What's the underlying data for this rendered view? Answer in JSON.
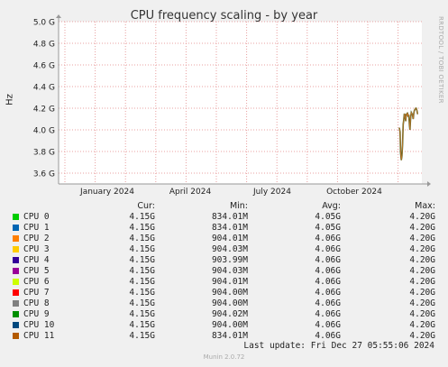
{
  "chart_data": {
    "type": "line",
    "title": "CPU frequency scaling - by year",
    "ylabel": "Hz",
    "y_ticks": [
      "3.6 G",
      "3.8 G",
      "4.0 G",
      "4.2 G",
      "4.4 G",
      "4.6 G",
      "4.8 G",
      "5.0 G"
    ],
    "y_tick_values": [
      3.6,
      3.8,
      4.0,
      4.2,
      4.4,
      4.6,
      4.8,
      5.0
    ],
    "ylim": [
      3.5,
      5.0
    ],
    "x_ticks": [
      "January 2024",
      "April 2024",
      "July 2024",
      "October 2024"
    ],
    "grid": true,
    "series_color": "#b8732a",
    "series_days": [
      0,
      0.7,
      1.4,
      2,
      2.6,
      3.2,
      3.9,
      4.5,
      5.1,
      5.8,
      6.4,
      7,
      7.6,
      8.2,
      8.9,
      9.5,
      10.1,
      10.7,
      11.4,
      12,
      12.6,
      13.2,
      13.9,
      14.5,
      15.1,
      15.8,
      16.4,
      17,
      17.6,
      18.3,
      18.9
    ],
    "series_values": [
      4.02,
      3.98,
      3.78,
      3.72,
      3.76,
      3.85,
      4.05,
      4.1,
      4.15,
      4.12,
      4.08,
      4.15,
      4.13,
      4.16,
      4.12,
      4.14,
      4.05,
      4.0,
      4.12,
      4.16,
      4.15,
      4.14,
      4.1,
      4.15,
      4.18,
      4.19,
      4.2,
      4.2,
      4.18,
      4.15,
      4.15
    ]
  },
  "legend_headers": {
    "cur": "Cur:",
    "min": "Min:",
    "avg": "Avg:",
    "max": "Max:"
  },
  "legend": [
    {
      "name": "CPU 0",
      "color": "#00cc00",
      "cur": "4.15G",
      "min": "834.01M",
      "avg": "4.05G",
      "max": "4.20G"
    },
    {
      "name": "CPU 1",
      "color": "#0066b3",
      "cur": "4.15G",
      "min": "834.01M",
      "avg": "4.05G",
      "max": "4.20G"
    },
    {
      "name": "CPU 2",
      "color": "#ff8000",
      "cur": "4.15G",
      "min": "904.01M",
      "avg": "4.06G",
      "max": "4.20G"
    },
    {
      "name": "CPU 3",
      "color": "#ffcc00",
      "cur": "4.15G",
      "min": "904.03M",
      "avg": "4.06G",
      "max": "4.20G"
    },
    {
      "name": "CPU 4",
      "color": "#330099",
      "cur": "4.15G",
      "min": "903.99M",
      "avg": "4.06G",
      "max": "4.20G"
    },
    {
      "name": "CPU 5",
      "color": "#990099",
      "cur": "4.15G",
      "min": "904.03M",
      "avg": "4.06G",
      "max": "4.20G"
    },
    {
      "name": "CPU 6",
      "color": "#ccff00",
      "cur": "4.15G",
      "min": "904.01M",
      "avg": "4.06G",
      "max": "4.20G"
    },
    {
      "name": "CPU 7",
      "color": "#ff0000",
      "cur": "4.15G",
      "min": "904.00M",
      "avg": "4.06G",
      "max": "4.20G"
    },
    {
      "name": "CPU 8",
      "color": "#808080",
      "cur": "4.15G",
      "min": "904.00M",
      "avg": "4.06G",
      "max": "4.20G"
    },
    {
      "name": "CPU 9",
      "color": "#008f00",
      "cur": "4.15G",
      "min": "904.02M",
      "avg": "4.06G",
      "max": "4.20G"
    },
    {
      "name": "CPU 10",
      "color": "#00487d",
      "cur": "4.15G",
      "min": "904.00M",
      "avg": "4.06G",
      "max": "4.20G"
    },
    {
      "name": "CPU 11",
      "color": "#b35a00",
      "cur": "4.15G",
      "min": "834.01M",
      "avg": "4.06G",
      "max": "4.20G"
    }
  ],
  "last_update": "Last update: Fri Dec 27 05:55:06 2024",
  "watermark": "RRDTOOL / TOBI OETIKER",
  "footer": "Munin 2.0.72"
}
